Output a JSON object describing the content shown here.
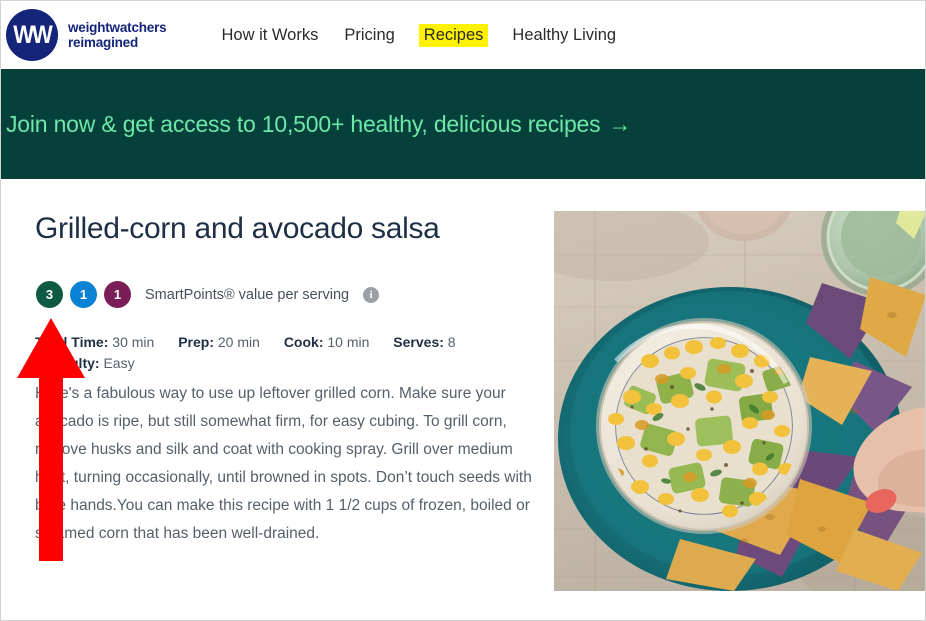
{
  "header": {
    "logo": {
      "mark_letters": "WW",
      "registered_mark": "®",
      "brand_line_1": "weightwatchers",
      "brand_line_2": "reimagined",
      "brand_color": "#14257a"
    },
    "nav": [
      {
        "label": "How it Works",
        "highlighted": false
      },
      {
        "label": "Pricing",
        "highlighted": false
      },
      {
        "label": "Recipes",
        "highlighted": true
      },
      {
        "label": "Healthy Living",
        "highlighted": false
      }
    ],
    "highlight_color": "#fff200"
  },
  "promo": {
    "text": "Join now & get access to 10,500+ healthy, delicious recipes",
    "arrow": "→",
    "background": "#06403b",
    "text_color": "#6ee8a8"
  },
  "recipe": {
    "title": "Grilled-corn and avocado salsa",
    "points": {
      "badges": [
        {
          "value": "3",
          "color": "#0e5a43"
        },
        {
          "value": "1",
          "color": "#0b82d4"
        },
        {
          "value": "1",
          "color": "#7b1d56"
        }
      ],
      "label": "SmartPoints® value per serving",
      "info_icon": "i"
    },
    "meta": [
      {
        "key": "Total Time:",
        "value": "30 min"
      },
      {
        "key": "Prep:",
        "value": "20 min"
      },
      {
        "key": "Cook:",
        "value": "10 min"
      },
      {
        "key": "Serves:",
        "value": "8"
      },
      {
        "key": "Difficulty:",
        "value": "Easy"
      }
    ],
    "description": "Here's a fabulous way to use up leftover grilled corn. Make sure your avocado is ripe, but still somewhat firm, for easy cubing. To grill corn, remove husks and silk and coat with cooking spray. Grill over medium heat, turning occasionally, until browned in spots. Don’t touch seeds with bare hands.You can make this recipe with 1 1/2 cups of frozen, boiled or steamed corn that has been well-drained.",
    "photo_alt": "Bowl of grilled-corn and avocado salsa on a teal platter surrounded by yellow and blue tortilla chips, with a hand reaching in and a drinking glass with lime"
  },
  "annotation": {
    "arrow_direction": "up",
    "arrow_color": "#fe0000"
  }
}
